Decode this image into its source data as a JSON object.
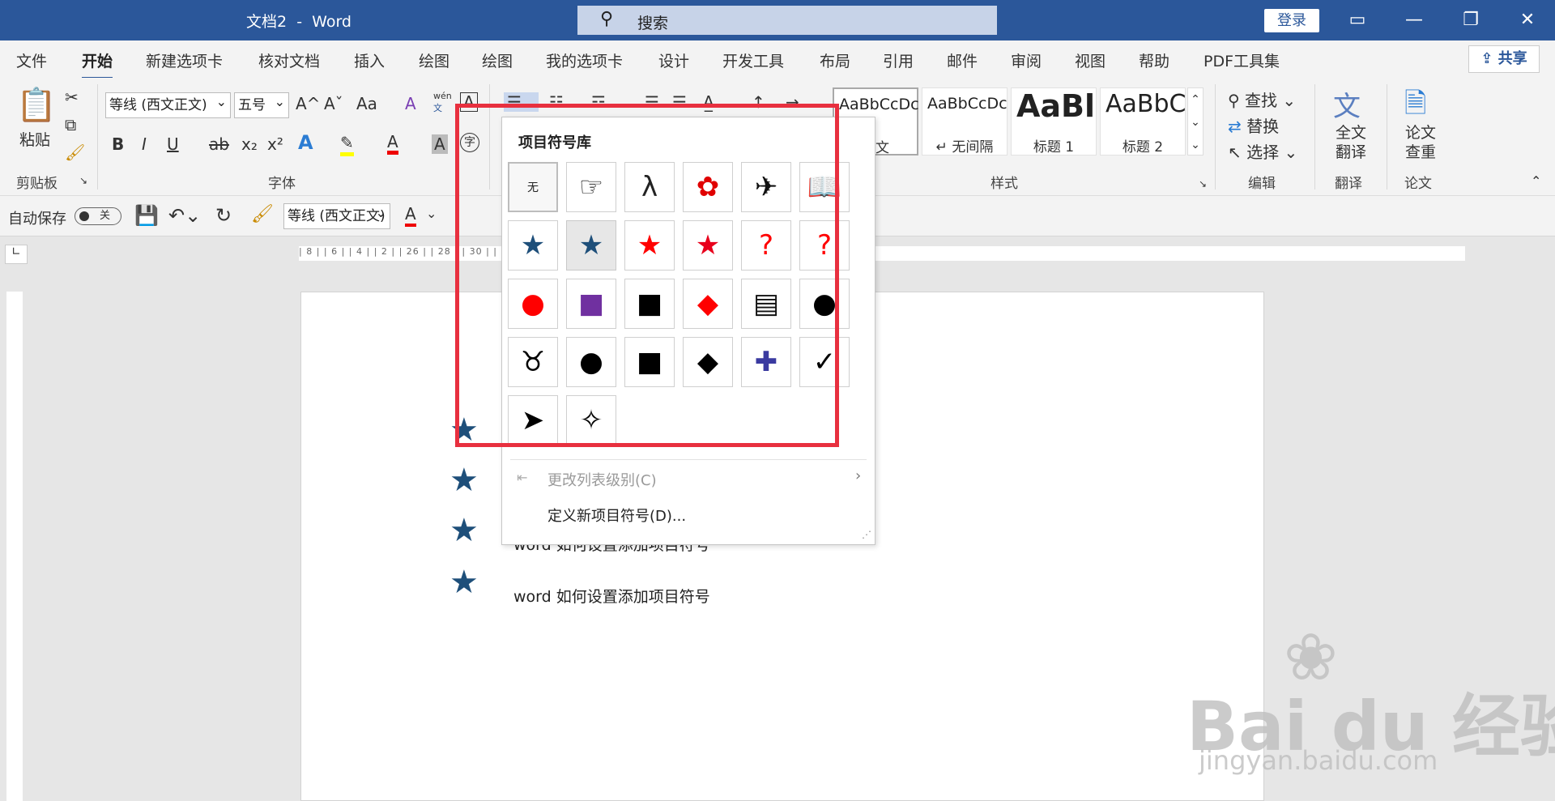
{
  "title": {
    "doc": "文档2",
    "sep": "-",
    "app": "Word"
  },
  "search": {
    "label": "搜索"
  },
  "account": {
    "login": "登录"
  },
  "window_controls": {
    "ribbon_display": "▭",
    "minimize": "—",
    "restore": "❐",
    "close": "✕"
  },
  "menu": {
    "tabs": [
      "文件",
      "开始",
      "新建选项卡",
      "核对文档",
      "插入",
      "绘图",
      "绘图",
      "我的选项卡",
      "设计",
      "开发工具",
      "布局",
      "引用",
      "邮件",
      "审阅",
      "视图",
      "帮助",
      "PDF工具集"
    ],
    "active_index": 1,
    "share": "共享"
  },
  "ribbon": {
    "clipboard": {
      "paste": "粘贴",
      "group": "剪贴板"
    },
    "font": {
      "name": "等线 (西文正文)",
      "size": "五号",
      "grow": "A^",
      "shrink": "Aˇ",
      "case": "Aa",
      "clear": "A",
      "phonetic": "wén",
      "phonetic_sub": "文",
      "border": "A",
      "bold": "B",
      "italic": "I",
      "underline": "U",
      "strike": "ab",
      "sub": "x₂",
      "sup": "x²",
      "effects": "A",
      "highlight": "✎",
      "color": "A",
      "shading": "A",
      "enclose": "字",
      "group": "字体"
    },
    "styles": {
      "cards": [
        {
          "preview": "AaBbCcDc",
          "name": "正文"
        },
        {
          "preview": "AaBbCcDc",
          "name": "↵ 无间隔"
        },
        {
          "preview": "AaBl",
          "name": "标题 1"
        },
        {
          "preview": "AaBbC",
          "name": "标题 2"
        }
      ],
      "group": "样式"
    },
    "editing": {
      "find": "查找",
      "replace": "替换",
      "select": "选择",
      "group": "编辑"
    },
    "translate": {
      "full": "全文",
      "full2": "翻译",
      "group": "翻译"
    },
    "paper": {
      "check": "论文",
      "check2": "查重",
      "group": "论文"
    }
  },
  "qat": {
    "autosave": "自动保存",
    "toggle": "关",
    "font": "等线 (西文正文)",
    "color_letter": "A"
  },
  "ruler": {
    "marks": "| 8 |   | 6 |   | 4 |   | 2 |                                                                                                            | 26 |   | 28 |   | 30 |   | 32 |   | 34 |   | 36 |   | 38 |   | 40 |   | 42 |   | 44 |   | 46 |   | 48"
  },
  "document": {
    "lines": [
      "word 如何设置添加项目符号",
      "word 如何设置添加项目符号"
    ]
  },
  "dropdown": {
    "title": "项目符号库",
    "symbols": [
      {
        "glyph": "无",
        "name": "none",
        "color": "#222"
      },
      {
        "glyph": "☞",
        "name": "pointing-hand",
        "color": "#222"
      },
      {
        "glyph": "λ",
        "name": "lambda",
        "color": "#222"
      },
      {
        "glyph": "✿",
        "name": "red-flower",
        "color": "#e00000"
      },
      {
        "glyph": "✈",
        "name": "airplane",
        "color": "#111"
      },
      {
        "glyph": "📖",
        "name": "open-book",
        "color": "#1e4f7a"
      },
      {
        "glyph": "★",
        "name": "blue-star",
        "color": "#1e4f7a"
      },
      {
        "glyph": "★",
        "name": "blue-star-current",
        "color": "#1e4f7a"
      },
      {
        "glyph": "★",
        "name": "red-star",
        "color": "#ff0000"
      },
      {
        "glyph": "★",
        "name": "red-star-2",
        "color": "#e8001c"
      },
      {
        "glyph": "?",
        "name": "red-question",
        "color": "#ff0000"
      },
      {
        "glyph": "?",
        "name": "red-question-2",
        "color": "#ff0000"
      },
      {
        "glyph": "●",
        "name": "red-circle",
        "color": "#ff0000"
      },
      {
        "glyph": "■",
        "name": "purple-square",
        "color": "#7030a0"
      },
      {
        "glyph": "■",
        "name": "black-square",
        "color": "#000"
      },
      {
        "glyph": "◆",
        "name": "red-diamond",
        "color": "#ff0000"
      },
      {
        "glyph": "▤",
        "name": "document",
        "color": "#111"
      },
      {
        "glyph": "●",
        "name": "black-circle",
        "color": "#000"
      },
      {
        "glyph": "♉",
        "name": "taurus",
        "color": "#000"
      },
      {
        "glyph": "●",
        "name": "black-circle-2",
        "color": "#000"
      },
      {
        "glyph": "■",
        "name": "black-square-2",
        "color": "#000"
      },
      {
        "glyph": "◆",
        "name": "black-diamond",
        "color": "#000"
      },
      {
        "glyph": "✚",
        "name": "colored-cross",
        "color": "#3a3aa0"
      },
      {
        "glyph": "✓",
        "name": "checkmark",
        "color": "#000"
      },
      {
        "glyph": "➤",
        "name": "arrowhead",
        "color": "#000"
      },
      {
        "glyph": "✧",
        "name": "four-point-star",
        "color": "#000"
      }
    ],
    "change_level": "更改列表级别(C)",
    "define_new": "定义新项目符号(D)..."
  },
  "watermark": {
    "logo": "Bai du 经验",
    "url": "jingyan.baidu.com"
  }
}
